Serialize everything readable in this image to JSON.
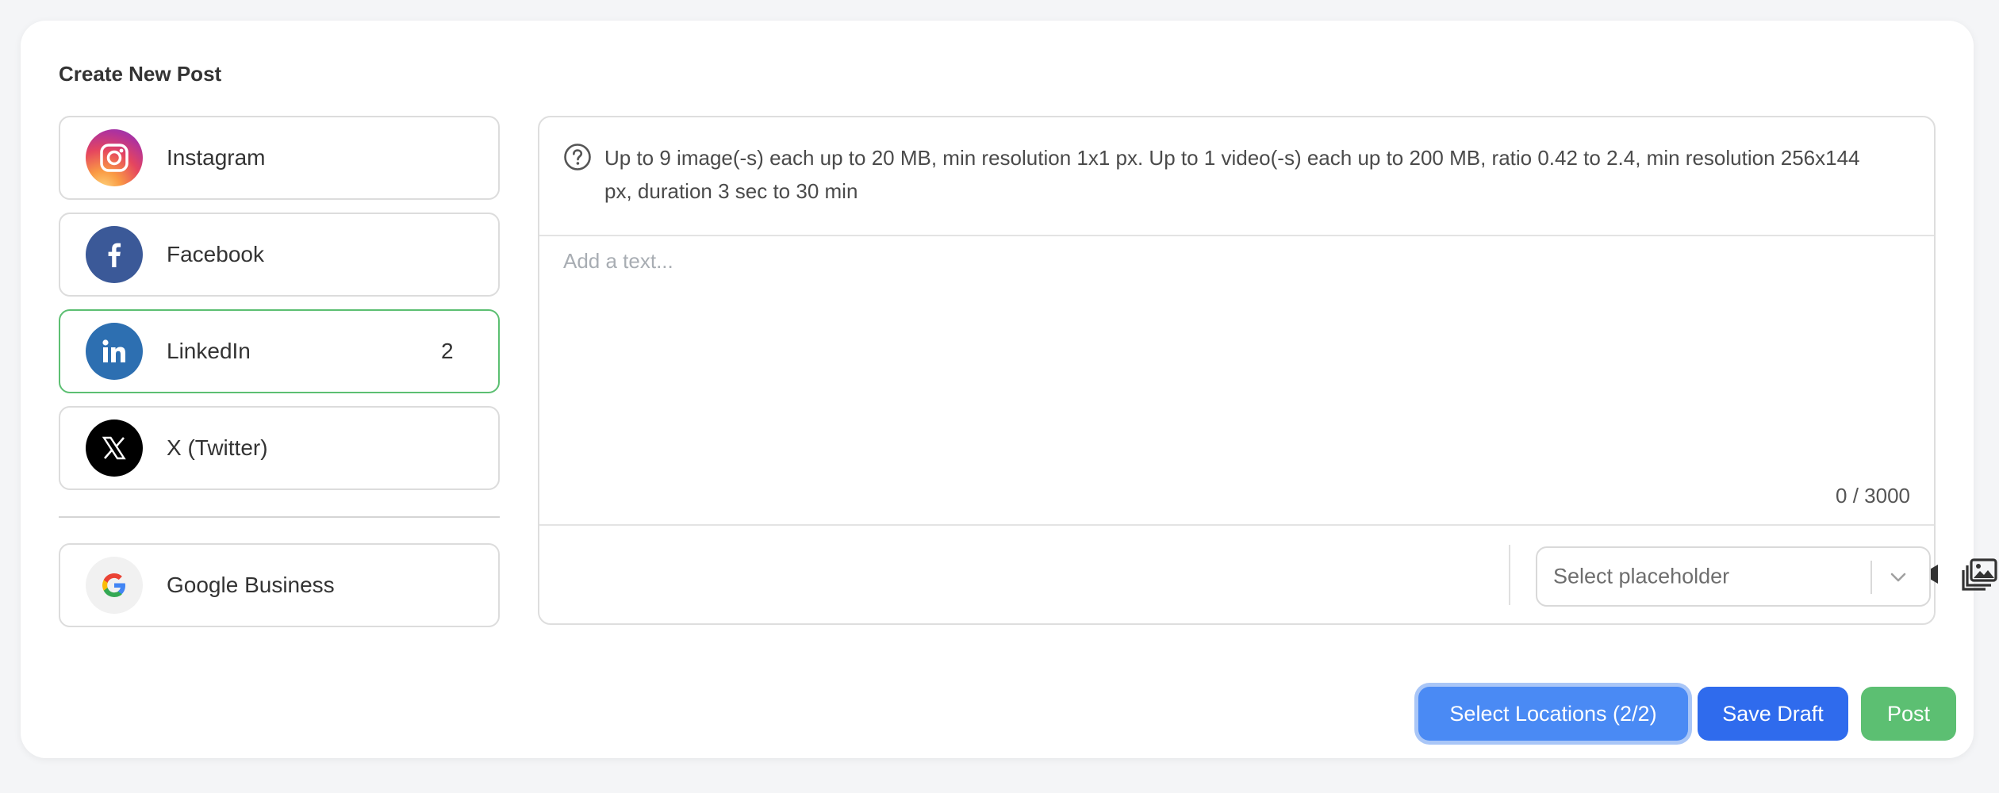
{
  "page": {
    "title": "Create New Post"
  },
  "networks": [
    {
      "name": "Instagram",
      "count": ""
    },
    {
      "name": "Facebook",
      "count": ""
    },
    {
      "name": "LinkedIn",
      "count": "2"
    },
    {
      "name": "X (Twitter)",
      "count": ""
    },
    {
      "name": "Google Business",
      "count": ""
    }
  ],
  "editor": {
    "info_text": "Up to 9 image(-s) each up to 20 MB, min resolution 1x1 px. Up to 1 video(-s) each up to 200 MB, ratio 0.42 to 2.4, min resolution 256x144 px, duration 3 sec to 30 min",
    "text_value": "",
    "text_placeholder": "Add a text...",
    "char_count": "0 / 3000",
    "placeholder_select": "Select placeholder",
    "tools": [
      "magic-wand-icon",
      "calendar-icon",
      "image-icon",
      "video-icon",
      "gallery-icon"
    ]
  },
  "actions": {
    "select_locations_label": "Select Locations (2/2)",
    "save_draft_label": "Save Draft",
    "post_label": "Post"
  },
  "colors": {
    "selected_border": "#5cbf72",
    "primary": "#2f6bed",
    "locations_button": "#4a8af4",
    "post_button": "#5cbf72",
    "facebook": "#3b5998",
    "linkedin": "#2d6fb1"
  }
}
